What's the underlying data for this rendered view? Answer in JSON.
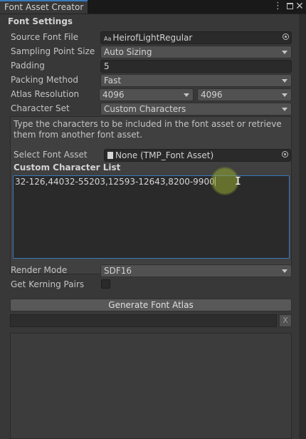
{
  "window": {
    "tab_title": "Font Asset Creator"
  },
  "section_title": "Font Settings",
  "fields": {
    "source_font": {
      "label": "Source Font File",
      "value": "HeirofLightRegular",
      "icon": "font-asset-icon"
    },
    "sampling": {
      "label": "Sampling Point Size",
      "value": "Auto Sizing"
    },
    "padding": {
      "label": "Padding",
      "value": "5"
    },
    "packing": {
      "label": "Packing Method",
      "value": "Fast"
    },
    "atlas": {
      "label": "Atlas Resolution",
      "width": "4096",
      "height": "4096"
    },
    "charset": {
      "label": "Character Set",
      "value": "Custom Characters"
    }
  },
  "custom_box": {
    "help_text": "Type the characters to be included in the font asset or retrieve them from another font asset.",
    "select_font_label": "Select Font Asset",
    "select_font_value": "None (TMP_Font Asset)",
    "list_label": "Custom Character List",
    "list_value": "32-126,44032-55203,12593-12643,8200-9900"
  },
  "render_mode": {
    "label": "Render Mode",
    "value": "SDF16"
  },
  "kerning": {
    "label": "Get Kerning Pairs",
    "checked": false
  },
  "generate_button": "Generate Font Atlas",
  "progress": {
    "fraction": 0.0,
    "cancel_label": "X"
  },
  "colors": {
    "accent": "#3a79bb",
    "background": "#383838",
    "field": "#2a2a2a",
    "dropdown": "#515151"
  }
}
